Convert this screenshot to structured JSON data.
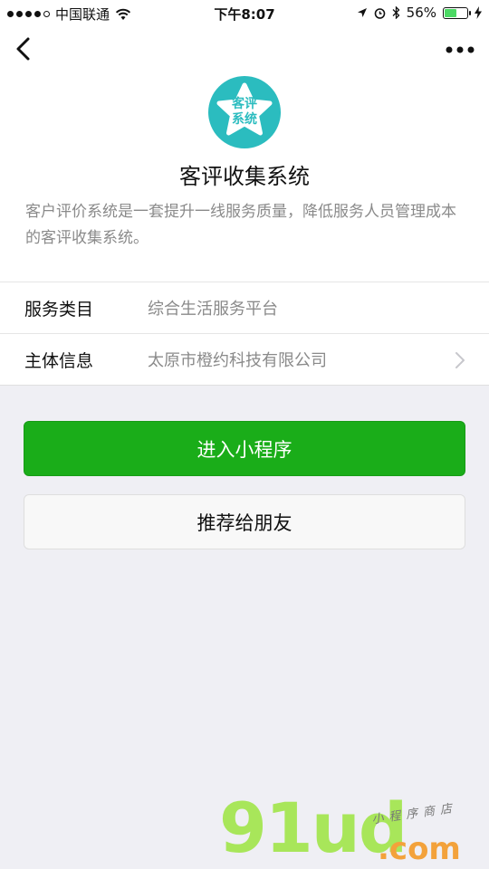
{
  "status_bar": {
    "carrier": "中国联通",
    "time": "下午8:07",
    "battery": "56%"
  },
  "app": {
    "logo_text_line1": "客评",
    "logo_text_line2": "系统",
    "title": "客评收集系统",
    "description": "客户评价系统是一套提升一线服务质量，降低服务人员管理成本的客评收集系统。"
  },
  "info": {
    "category_label": "服务类目",
    "category_value": "综合生活服务平台",
    "entity_label": "主体信息",
    "entity_value": "太原市橙约科技有限公司"
  },
  "actions": {
    "enter_label": "进入小程序",
    "share_label": "推荐给朋友"
  },
  "watermark": {
    "brand": "91ud",
    "domain": ".com",
    "tagline": "小程序商店"
  },
  "colors": {
    "primary": "#1aad19",
    "logo": "#2bbcbf"
  }
}
